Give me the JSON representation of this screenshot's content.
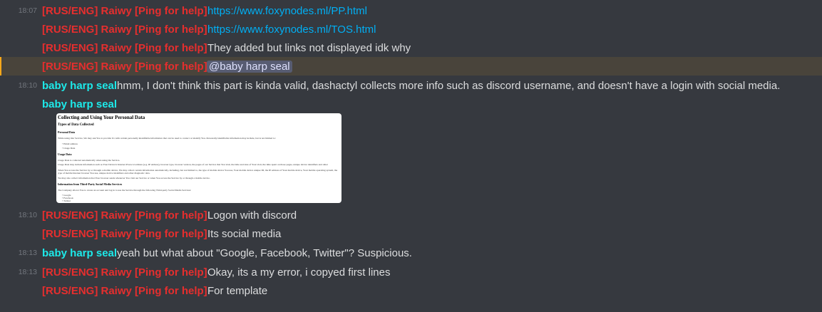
{
  "messages": [
    {
      "time": "18:07",
      "author": "[RUS/ENG] Raiwy [Ping for help]",
      "text": "https://www.foxynodes.ml/PP.html"
    },
    {
      "time": "",
      "author": "[RUS/ENG] Raiwy [Ping for help]",
      "text": "https://www.foxynodes.ml/TOS.html"
    },
    {
      "time": "",
      "author": "[RUS/ENG] Raiwy [Ping for help]",
      "text": "They added but links not displayed idk why"
    },
    {
      "time": "",
      "author": "[RUS/ENG] Raiwy [Ping for help]",
      "text": "@baby harp seal"
    },
    {
      "time": "18:10",
      "author": "baby harp seal",
      "text": "hmm, I don't think this part is kinda valid, dashactyl collects more info such as discord username, and doesn't have a login with social media."
    },
    {
      "time": "",
      "author": "baby harp seal",
      "text": ""
    },
    {
      "time": "18:10",
      "author": "[RUS/ENG] Raiwy [Ping for help]",
      "text": "Logon with discord"
    },
    {
      "time": "",
      "author": "[RUS/ENG] Raiwy [Ping for help]",
      "text": "Its social media"
    },
    {
      "time": "18:13",
      "author": "baby harp seal",
      "text": "yeah but what about \"Google, Facebook, Twitter\"? Suspicious."
    },
    {
      "time": "18:13",
      "author": "[RUS/ENG] Raiwy [Ping for help]",
      "text": "Okay, its a my error, i copyed first lines"
    },
    {
      "time": "",
      "author": "[RUS/ENG] Raiwy [Ping for help]",
      "text": "For template"
    }
  ],
  "attachment": {
    "title": "Collecting and Using Your Personal Data",
    "h_types": "Types of Data Collected",
    "h_personal": "Personal Data",
    "p_personal": "While using Our Service, We may ask You to provide Us with certain personally identifiable information that can be used to contact or identify You. Personally identifiable information may include, but is not limited to:",
    "li_email": "Email address",
    "li_usage": "Usage Data",
    "h_usage": "Usage Data",
    "p_usage1": "Usage Data is collected automatically when using the Service.",
    "p_usage2": "Usage Data may include information such as Your Device's Internet Protocol address (e.g. IP address), browser type, browser version, the pages of our Service that You visit, the time and date of Your visit, the time spent on those pages, unique device identifiers and other diagnostic data.",
    "p_usage3": "When You access the Service by or through a mobile device, We may collect certain information automatically, including, but not limited to, the type of mobile device You use, Your mobile device unique ID, the IP address of Your mobile device, Your mobile operating system, the type of mobile Internet browser You use, unique device identifiers and other diagnostic data.",
    "p_usage4": "We may also collect information that Your browser sends whenever You visit our Service or when You access the Service by or through a mobile device.",
    "h_third": "Information from Third-Party Social Media Services",
    "p_third": "The Company allows You to create an account and log in to use the Service through the following Third-party Social Media Services:",
    "li_google": "Google",
    "li_facebook": "Facebook",
    "li_twitter": "Twitter"
  },
  "colors": {
    "background": "#36393f",
    "author_raiwy": "#e62e2e",
    "author_seal": "#1de9e9",
    "link": "#00aff4",
    "timestamp": "#72767d",
    "mention_highlight": "#faa81a"
  }
}
